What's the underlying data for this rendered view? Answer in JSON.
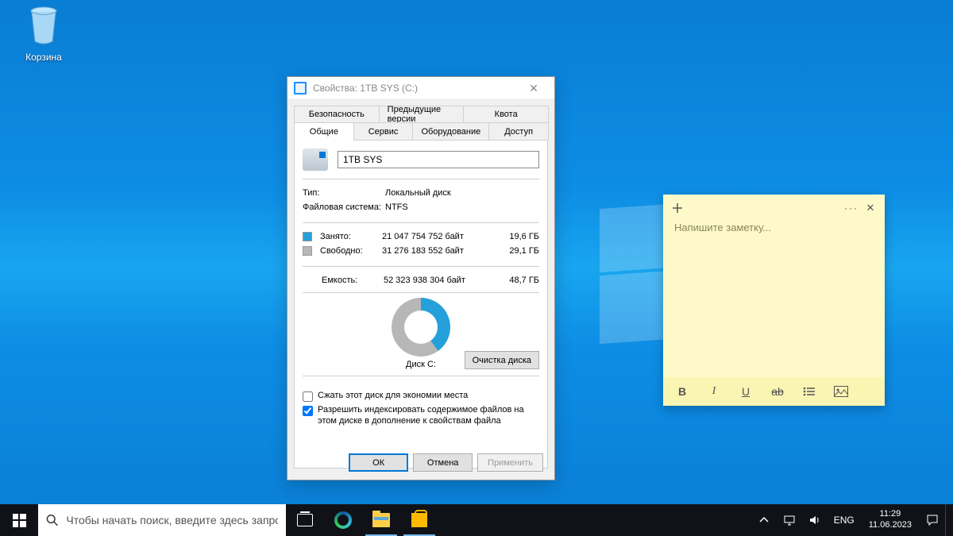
{
  "desktop": {
    "recycle_bin_label": "Корзина"
  },
  "properties_window": {
    "title": "Свойства: 1TB SYS (C:)",
    "tabs_row1": [
      "Безопасность",
      "Предыдущие версии",
      "Квота"
    ],
    "tabs_row2": [
      "Общие",
      "Сервис",
      "Оборудование",
      "Доступ"
    ],
    "active_tab": "Общие",
    "drive_name": "1TB SYS",
    "type_label": "Тип:",
    "type_value": "Локальный диск",
    "fs_label": "Файловая система:",
    "fs_value": "NTFS",
    "used_label": "Занято:",
    "used_bytes": "21 047 754 752 байт",
    "used_gb": "19,6 ГБ",
    "free_label": "Свободно:",
    "free_bytes": "31 276 183 552 байт",
    "free_gb": "29,1 ГБ",
    "capacity_label": "Емкость:",
    "capacity_bytes": "52 323 938 304 байт",
    "capacity_gb": "48,7 ГБ",
    "disk_label": "Диск C:",
    "cleanup_button": "Очистка диска",
    "compress_checkbox": "Сжать этот диск для экономии места",
    "index_checkbox": "Разрешить индексировать содержимое файлов на этом диске в дополнение к свойствам файла",
    "ok_button": "ОК",
    "cancel_button": "Отмена",
    "apply_button": "Применить"
  },
  "sticky_note": {
    "placeholder": "Напишите заметку...",
    "bold": "B",
    "italic": "I",
    "underline": "U",
    "strike": "ab"
  },
  "taskbar": {
    "search_placeholder": "Чтобы начать поиск, введите здесь запрос",
    "language": "ENG",
    "time": "11:29",
    "date": "11.06.2023"
  },
  "chart_data": {
    "type": "pie",
    "series": [
      {
        "name": "Занято",
        "value": 21047754752,
        "gb": 19.6,
        "color": "#26a0da"
      },
      {
        "name": "Свободно",
        "value": 31276183552,
        "gb": 29.1,
        "color": "#b7b7b7"
      }
    ],
    "total": {
      "label": "Емкость",
      "value": 52323938304,
      "gb": 48.7
    },
    "title": "Диск C:"
  }
}
